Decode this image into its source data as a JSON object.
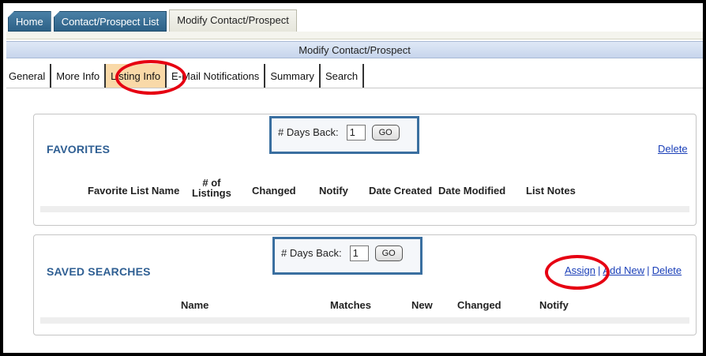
{
  "top_tabs": [
    "Home",
    "Contact/Prospect List",
    "Modify Contact/Prospect"
  ],
  "page_title": "Modify Contact/Prospect",
  "sub_tabs": [
    "General",
    "More Info",
    "Listing Info",
    "E-Mail Notifications",
    "Summary",
    "Search"
  ],
  "selected_sub_tab": "Listing Info",
  "favorites": {
    "title": "FAVORITES",
    "days_back_label": "# Days Back:",
    "days_back_value": "1",
    "go_label": "GO",
    "delete_label": "Delete",
    "columns": {
      "list_name": "Favorite List Name",
      "listings_line1": "# of",
      "listings_line2": "Listings",
      "changed": "Changed",
      "notify": "Notify",
      "date_created": "Date Created",
      "date_modified": "Date Modified",
      "list_notes": "List Notes"
    }
  },
  "saved_searches": {
    "title": "SAVED SEARCHES",
    "days_back_label": "# Days Back:",
    "days_back_value": "1",
    "go_label": "GO",
    "assign_label": "Assign",
    "add_new_label": "Add New",
    "delete_label": "Delete",
    "separator": "|",
    "columns": {
      "name": "Name",
      "matches": "Matches",
      "new": "New",
      "changed": "Changed",
      "notify": "Notify"
    }
  },
  "colors": {
    "tab_blue": "#2d6187",
    "title_bar": "#c7d5ec",
    "selected_tab": "#f9d9a8",
    "section_title": "#2f5f93",
    "days_box_border": "#3a6fa0",
    "link": "#1a3fb8",
    "highlight_ring": "#e60012"
  }
}
